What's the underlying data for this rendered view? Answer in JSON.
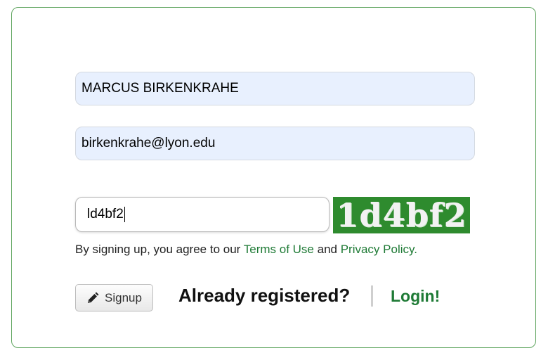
{
  "form": {
    "name_value": "MARCUS BIRKENKRAHE",
    "email_value": "birkenkrahe@lyon.edu",
    "captcha_input_value": "ld4bf2",
    "captcha_image_text": "1d4bf2"
  },
  "terms": {
    "prefix": "By signing up, you agree to our ",
    "terms_link": "Terms of Use",
    "middle": " and ",
    "privacy_link": "Privacy Policy."
  },
  "actions": {
    "signup_label": "Signup",
    "signup_icon": "pencil-icon",
    "already_text": "Already registered?",
    "separator": "|",
    "login_label": "Login!"
  },
  "colors": {
    "card_border": "#5fa55f",
    "link": "#1e7a35",
    "captcha_bg": "#2e8b2e",
    "autofill_bg": "#e8f0fe"
  }
}
